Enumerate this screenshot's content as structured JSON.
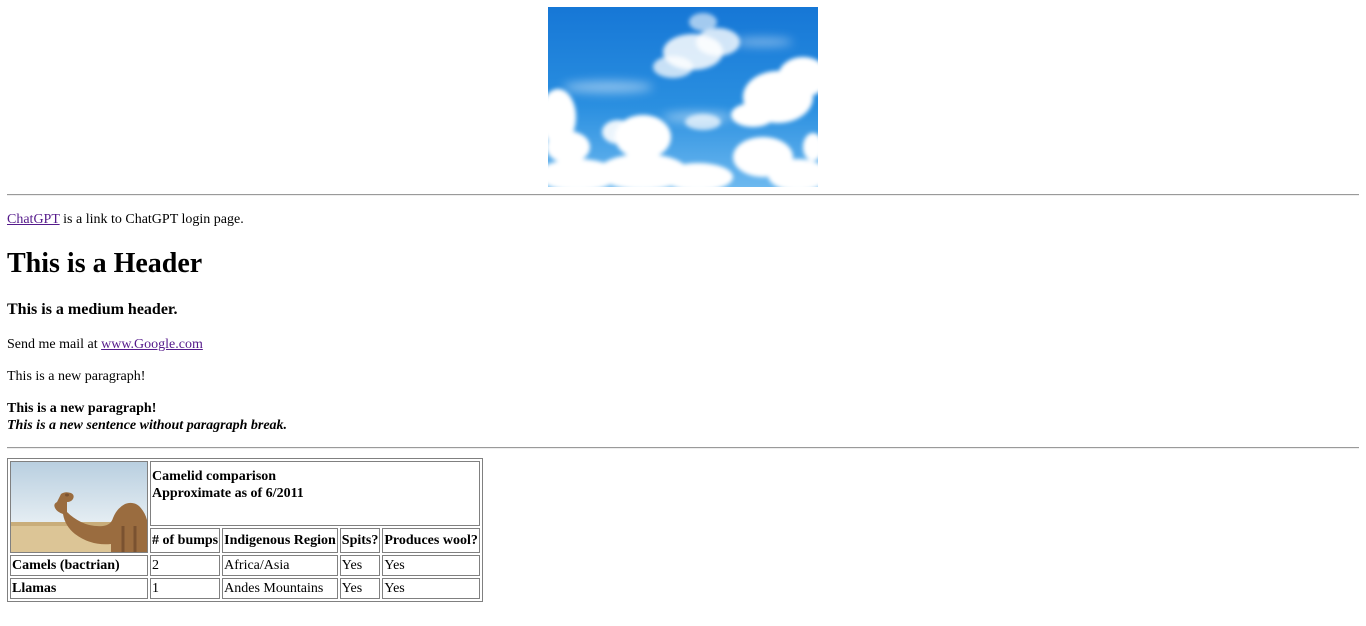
{
  "link_line": {
    "link_text": "ChatGPT",
    "rest": " is a link to ChatGPT login page."
  },
  "header_large": "This is a Header",
  "header_medium": "This is a medium header.",
  "mail_line": {
    "prefix": "Send me mail at ",
    "link_text": "www.Google.com"
  },
  "paragraph_1": "This is a new paragraph!",
  "paragraph_2": {
    "bold": "This is a new paragraph!",
    "italic": "This is a new sentence without paragraph break."
  },
  "table": {
    "caption_line1": "Camelid comparison",
    "caption_line2": "Approximate as of 6/2011",
    "headers": [
      "# of bumps",
      "Indigenous Region",
      "Spits?",
      "Produces wool?"
    ],
    "rows": [
      {
        "name": "Camels (bactrian)",
        "cells": [
          "2",
          "Africa/Asia",
          "Yes",
          "Yes"
        ]
      },
      {
        "name": "Llamas",
        "cells": [
          "1",
          "Andes Mountains",
          "Yes",
          "Yes"
        ]
      }
    ]
  },
  "colors": {
    "link_visited": "#551a8b",
    "sky_blue": "#2a8fe0"
  }
}
